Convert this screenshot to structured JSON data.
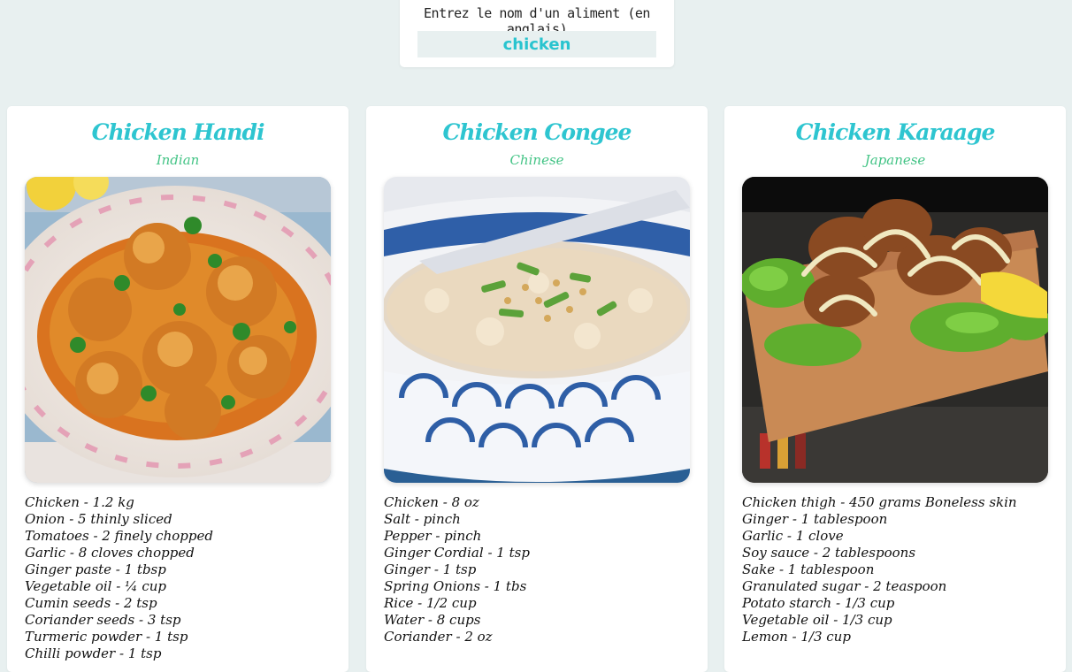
{
  "search": {
    "label": "Entrez le nom d'un aliment (en anglais)",
    "value": "chicken"
  },
  "colors": {
    "background": "#e8f0f0",
    "title": "#2ec5d0",
    "cuisine": "#44c486",
    "input_text": "#29c4cf"
  },
  "recipes": [
    {
      "title": "Chicken Handi",
      "cuisine": "Indian",
      "image_icon": "curry-dish-image",
      "ingredients": [
        "Chicken - 1.2 kg",
        "Onion - 5 thinly sliced",
        "Tomatoes - 2 finely chopped",
        "Garlic - 8 cloves chopped",
        "Ginger paste - 1 tbsp",
        "Vegetable oil - ¼ cup",
        "Cumin seeds - 2 tsp",
        "Coriander seeds - 3 tsp",
        "Turmeric powder - 1 tsp",
        "Chilli powder - 1 tsp"
      ]
    },
    {
      "title": "Chicken Congee",
      "cuisine": "Chinese",
      "image_icon": "congee-bowl-image",
      "ingredients": [
        "Chicken - 8 oz",
        "Salt - pinch",
        "Pepper - pinch",
        "Ginger Cordial - 1 tsp",
        "Ginger - 1 tsp",
        "Spring Onions - 1 tbs",
        "Rice - 1/2 cup",
        "Water - 8 cups",
        "Coriander - 2 oz"
      ]
    },
    {
      "title": "Chicken Karaage",
      "cuisine": "Japanese",
      "image_icon": "fried-chicken-board-image",
      "ingredients": [
        "Chicken thigh - 450 grams Boneless skin",
        "Ginger - 1 tablespoon",
        "Garlic - 1 clove",
        "Soy sauce - 2 tablespoons",
        "Sake - 1 tablespoon",
        "Granulated sugar - 2 teaspoon",
        "Potato starch - 1/3 cup",
        "Vegetable oil - 1/3 cup",
        "Lemon - 1/3 cup"
      ]
    }
  ]
}
